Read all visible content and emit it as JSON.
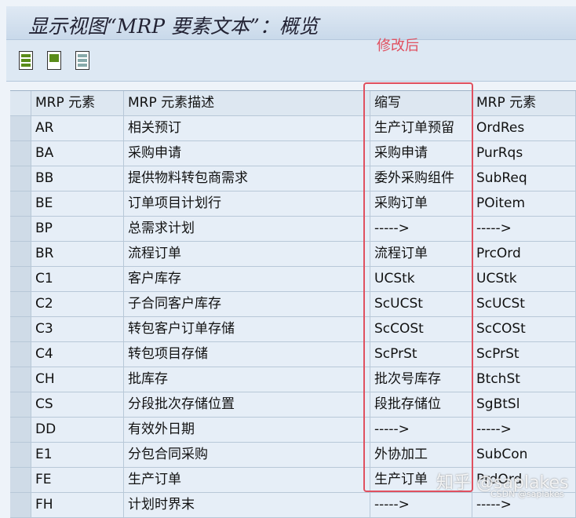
{
  "title": "显示视图“MRP 要素文本”：概览",
  "annotation": "修改后",
  "columns": [
    "MRP 元素",
    "MRP 元素描述",
    "缩写",
    "MRP 元素"
  ],
  "rows": [
    [
      "AR",
      "相关预订",
      "生产订单预留",
      "OrdRes"
    ],
    [
      "BA",
      "采购申请",
      "采购申请",
      "PurRqs"
    ],
    [
      "BB",
      "提供物料转包商需求",
      "委外采购组件",
      "SubReq"
    ],
    [
      "BE",
      "订单项目计划行",
      "采购订单",
      "POitem"
    ],
    [
      "BP",
      "总需求计划",
      "----->",
      "----->"
    ],
    [
      "BR",
      "流程订单",
      "流程订单",
      "PrcOrd"
    ],
    [
      "C1",
      "客户库存",
      "UCStk",
      "UCStk"
    ],
    [
      "C2",
      "子合同客户库存",
      "ScUCSt",
      "ScUCSt"
    ],
    [
      "C3",
      "转包客户订单存储",
      "ScCOSt",
      "ScCOSt"
    ],
    [
      "C4",
      "转包项目存储",
      "ScPrSt",
      "ScPrSt"
    ],
    [
      "CH",
      "批库存",
      "批次号库存",
      "BtchSt"
    ],
    [
      "CS",
      "分段批次存储位置",
      "段批存储位",
      "SgBtSl"
    ],
    [
      "DD",
      "有效外日期",
      "----->",
      "----->"
    ],
    [
      "E1",
      "分包合同采购",
      "外协加工",
      "SubCon"
    ],
    [
      "FE",
      "生产订单",
      "生产订单",
      "PrdOrd"
    ],
    [
      "FH",
      "计划时界末",
      "----->",
      "----->"
    ]
  ],
  "watermarks": [
    "知乎 @saplakes",
    "CSDN @saplakes"
  ]
}
